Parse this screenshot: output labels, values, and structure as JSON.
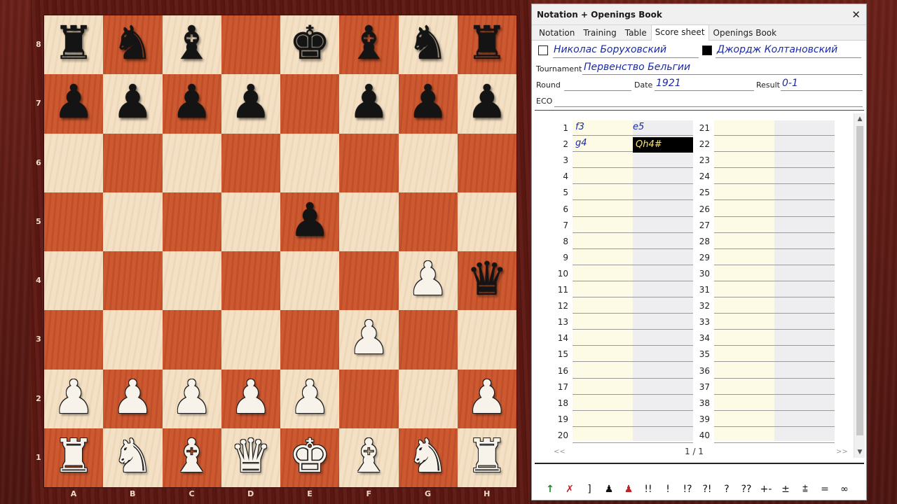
{
  "board": {
    "files": [
      "A",
      "B",
      "C",
      "D",
      "E",
      "F",
      "G",
      "H"
    ],
    "ranks": [
      "8",
      "7",
      "6",
      "5",
      "4",
      "3",
      "2",
      "1"
    ],
    "position": [
      [
        "bR",
        "bN",
        "bB",
        "",
        "bK",
        "bB",
        "bN",
        "bR"
      ],
      [
        "bP",
        "bP",
        "bP",
        "bP",
        "",
        "bP",
        "bP",
        "bP"
      ],
      [
        "",
        "",
        "",
        "",
        "",
        "",
        "",
        ""
      ],
      [
        "",
        "",
        "",
        "",
        "bP",
        "",
        "",
        ""
      ],
      [
        "",
        "",
        "",
        "",
        "",
        "",
        "wP",
        "bQ"
      ],
      [
        "",
        "",
        "",
        "",
        "",
        "wP",
        "",
        ""
      ],
      [
        "wP",
        "wP",
        "wP",
        "wP",
        "wP",
        "",
        "",
        "wP"
      ],
      [
        "wR",
        "wN",
        "wB",
        "wQ",
        "wK",
        "wB",
        "wN",
        "wR"
      ]
    ],
    "colors": {
      "light": "#f3dfc2",
      "dark": "#c9552d"
    }
  },
  "panel": {
    "title": "Notation + Openings Book",
    "close_symbol": "✕",
    "tabs": [
      "Notation",
      "Training",
      "Table",
      "Score sheet",
      "Openings Book"
    ],
    "active_tab": "Score sheet",
    "white_player": "Николас Боруховский",
    "black_player": "Джордж Колтановский",
    "tournament_label": "Tournament",
    "tournament": "Первенство Бельгии",
    "round_label": "Round",
    "round": "",
    "date_label": "Date",
    "date": "1921",
    "result_label": "Result",
    "result": "0-1",
    "eco_label": "ECO",
    "eco": ""
  },
  "score_sheet": {
    "left_numbers": [
      "1",
      "2",
      "3",
      "4",
      "5",
      "6",
      "7",
      "8",
      "9",
      "10",
      "11",
      "12",
      "13",
      "14",
      "15",
      "16",
      "17",
      "18",
      "19",
      "20"
    ],
    "right_numbers": [
      "21",
      "22",
      "23",
      "24",
      "25",
      "26",
      "27",
      "28",
      "29",
      "30",
      "31",
      "32",
      "33",
      "34",
      "35",
      "36",
      "37",
      "38",
      "39",
      "40"
    ],
    "moves": [
      {
        "white": "f3",
        "black": "e5"
      },
      {
        "white": "g4",
        "black": "Qh4#"
      }
    ],
    "highlighted_move": "Qh4#",
    "pager_prev": "<<",
    "pager_next": ">>",
    "page": "1 / 1"
  },
  "toolbar": {
    "items": [
      {
        "name": "arrow-up-icon",
        "label": "↑",
        "style": "green"
      },
      {
        "name": "delete-move-icon",
        "label": "✗",
        "style": "red"
      },
      {
        "name": "bracket-icon",
        "label": "]",
        "style": ""
      },
      {
        "name": "black-pawn-icon",
        "label": "♟",
        "style": ""
      },
      {
        "name": "red-pawn-icon",
        "label": "♟",
        "style": "red"
      },
      {
        "name": "brilliant-move",
        "label": "!!",
        "style": ""
      },
      {
        "name": "good-move",
        "label": "!",
        "style": ""
      },
      {
        "name": "interesting-move",
        "label": "!?",
        "style": ""
      },
      {
        "name": "dubious-move",
        "label": "?!",
        "style": ""
      },
      {
        "name": "mistake",
        "label": "?",
        "style": ""
      },
      {
        "name": "blunder",
        "label": "??",
        "style": ""
      },
      {
        "name": "white-winning",
        "label": "+-",
        "style": ""
      },
      {
        "name": "white-better",
        "label": "±",
        "style": ""
      },
      {
        "name": "white-slightly-better",
        "label": "⩲",
        "style": ""
      },
      {
        "name": "equal",
        "label": "=",
        "style": ""
      },
      {
        "name": "unclear",
        "label": "∞",
        "style": ""
      }
    ]
  }
}
